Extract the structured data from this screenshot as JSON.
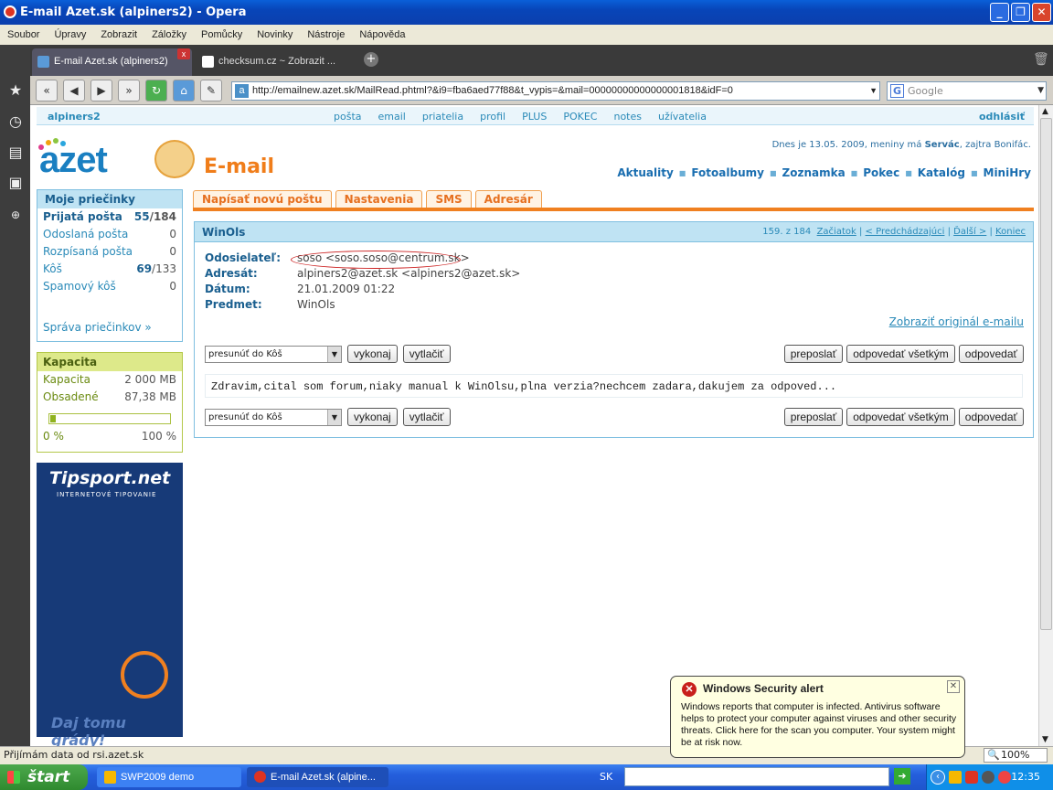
{
  "window": {
    "title": "E-mail Azet.sk (alpiners2) - Opera",
    "min": "_",
    "max": "❐",
    "close": "✕"
  },
  "menu": [
    "Soubor",
    "Úpravy",
    "Zobrazit",
    "Záložky",
    "Pomůcky",
    "Novinky",
    "Nástroje",
    "Nápověda"
  ],
  "tabs": [
    {
      "label": "E-mail Azet.sk (alpiners2)"
    },
    {
      "label": "checksum.cz ~ Zobrazit ..."
    }
  ],
  "nav": {
    "url": "http://emailnew.azet.sk/MailRead.phtml?&i9=fba6aed77f88&t_vypis=&mail=00000000000000001818&idF=0",
    "search_placeholder": "Google"
  },
  "site": {
    "user": "alpiners2",
    "top_links": [
      "pošta",
      "email",
      "priatelia",
      "profil",
      "PLUS",
      "POKEC",
      "notes",
      "užívatelia"
    ],
    "logout": "odhlásiť",
    "logo": "azet",
    "section_title": "E-mail",
    "date_prefix": "Dnes je 13.05. 2009, meniny má ",
    "date_name": "Servác",
    "date_suffix": ", zajtra Bonifác.",
    "portal_links": [
      "Aktuality",
      "Fotoalbumy",
      "Zoznamka",
      "Pokec",
      "Katalóg",
      "MiniHry"
    ]
  },
  "folders": {
    "title": "Moje priečinky",
    "items": [
      {
        "name": "Prijatá pošta",
        "count": "55",
        "total": "/184"
      },
      {
        "name": "Odoslaná pošta",
        "count": "0",
        "total": ""
      },
      {
        "name": "Rozpísaná pošta",
        "count": "0",
        "total": ""
      },
      {
        "name": "Kôš",
        "count": "69",
        "total": "/133"
      },
      {
        "name": "Spamový kôš",
        "count": "0",
        "total": ""
      }
    ],
    "manage": "Správa priečinkov »"
  },
  "capacity": {
    "title": "Kapacita",
    "rows": [
      {
        "label": "Kapacita",
        "value": "2 000 MB"
      },
      {
        "label": "Obsadené",
        "value": "87,38 MB"
      }
    ],
    "fill_fraction": 0.044,
    "min": "0 %",
    "max": "100 %"
  },
  "ad": {
    "brand": "Tipsport.net",
    "sub": "INTERNETOVÉ TIPOVANIE",
    "slogan": "Daj tomu grády!"
  },
  "action_tabs": [
    "Napísať novú poštu",
    "Nastavenia",
    "SMS",
    "Adresár"
  ],
  "message": {
    "subject": "WinOls",
    "position": "159. z 184",
    "pager": [
      "Začiatok",
      "< Predchádzajúci",
      "Ďalší >",
      "Koniec"
    ],
    "fields": [
      {
        "key": "Odosielateľ:",
        "value": "soso <soso.soso@centrum.sk>"
      },
      {
        "key": "Adresát:",
        "value": "alpiners2@azet.sk <alpiners2@azet.sk>"
      },
      {
        "key": "Dátum:",
        "value": "21.01.2009 01:22"
      },
      {
        "key": "Predmet:",
        "value": "WinOls"
      }
    ],
    "show_original": "Zobraziť originál e-mailu",
    "move_option": "presunúť do Kôš",
    "btn_execute": "vykonaj",
    "btn_print": "vytlačiť",
    "btn_forward": "preposlať",
    "btn_reply_all": "odpovedať všetkým",
    "btn_reply": "odpovedať",
    "body": "Zdravim,cital som forum,niaky manual k WinOlsu,plna verzia?nechcem zadara,dakujem za odpoved..."
  },
  "status": {
    "text": "Přijímám data od rsi.azet.sk",
    "zoom": "100%"
  },
  "taskbar": {
    "start": "štart",
    "items": [
      "SWP2009 demo",
      "E-mail Azet.sk (alpine..."
    ],
    "lang": "SK",
    "clock": "12:35"
  },
  "alert": {
    "title": "Windows Security alert",
    "text": "Windows reports that computer is infected. Antivirus software helps to protect your computer against viruses and other security threats. Click here for the scan you computer. Your system might be at risk now."
  }
}
